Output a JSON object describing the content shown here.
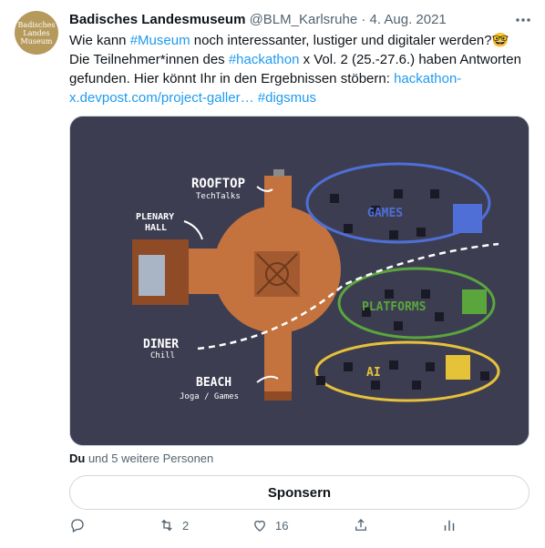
{
  "tweet": {
    "author_name": "Badisches Landesmuseum",
    "handle": "@BLM_Karlsruhe",
    "separator": "·",
    "date": "4. Aug. 2021",
    "avatar_text": [
      "Badisches",
      "Landes",
      "Museum"
    ],
    "text": {
      "p1": "Wie kann ",
      "tag_museum": "#Museum",
      "p2": " noch interessanter, lustiger und digitaler werden?",
      "emoji": "🤓",
      "p3": "Die Teilnehmer*innen des ",
      "tag_hackathon": "#hackathon",
      "p4": " x Vol. 2 (25.-27.6.) haben Antworten gefunden. Hier könnt Ihr in den Ergebnissen stöbern: ",
      "url": "hackathon-x.devpost.com/project-galler…",
      "tag_digsmus": "#digsmus"
    },
    "media": {
      "labels": {
        "rooftop": "ROOFTOP",
        "rooftop_sub": "TechTalks",
        "plenary1": "PLENARY",
        "plenary2": "HALL",
        "games": "GAMES",
        "platforms": "PLATFORMS",
        "ai": "AI",
        "diner": "DINER",
        "diner_sub": "Chill",
        "beach": "BEACH",
        "beach_sub": "Joga / Games"
      },
      "colors": {
        "background": "#3d3d52",
        "floor": "#c4733e",
        "games": "#4f6fd6",
        "platforms": "#5aa63c",
        "ai": "#e6c239"
      }
    },
    "likes_by": {
      "first": "Du",
      "rest": " und 5 weitere Personen"
    },
    "sponsor_label": "Sponsern",
    "actions": {
      "retweets": "2",
      "likes": "16"
    }
  }
}
